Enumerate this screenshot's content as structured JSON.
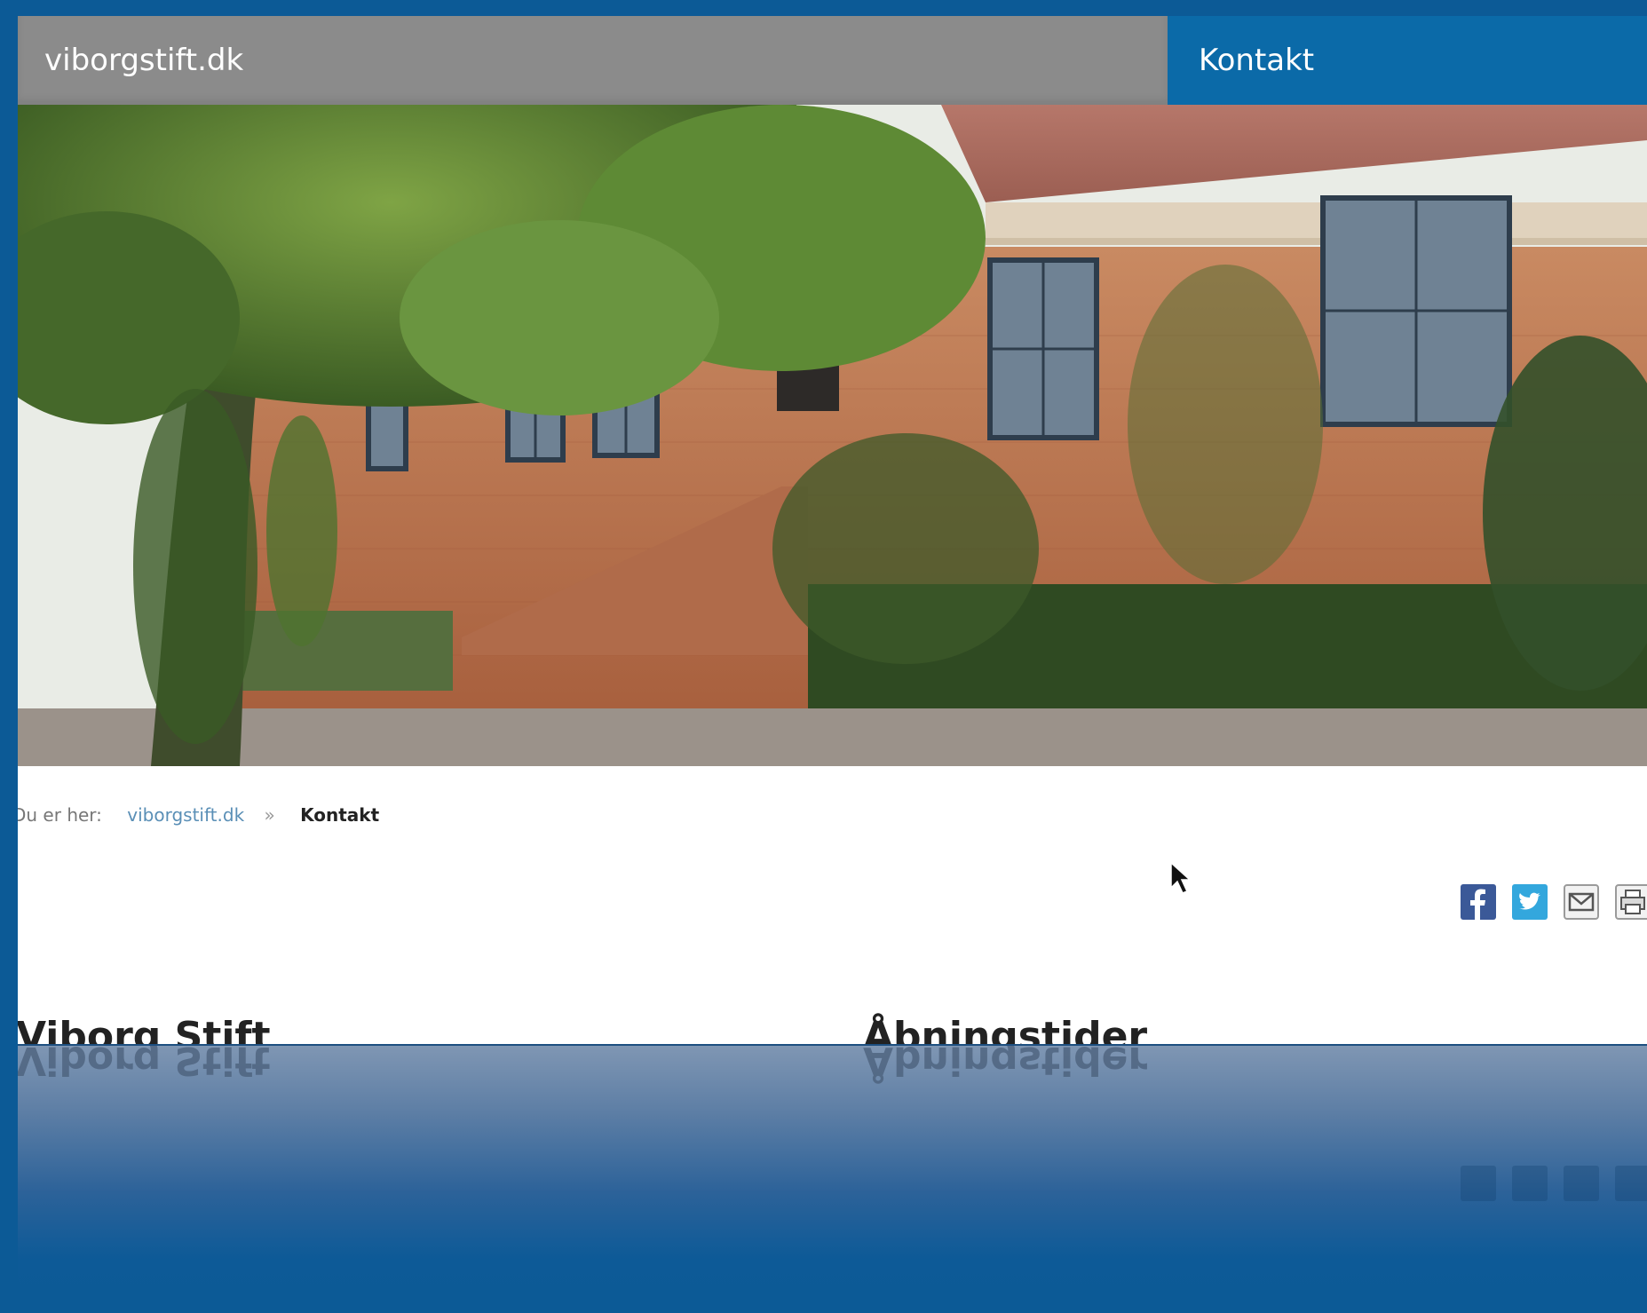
{
  "header": {
    "site_title": "viborgstift.dk",
    "nav_link": "Kontakt"
  },
  "hero": {
    "image": "Brick building with tree and garden"
  },
  "breadcrumb": {
    "prefix": "Du er her:",
    "home": "viborgstift.dk",
    "separator": "»",
    "current": "Kontakt"
  },
  "share": {
    "icons": [
      "facebook-icon",
      "twitter-icon",
      "email-icon",
      "print-icon"
    ]
  },
  "sections": {
    "left_heading": "Viborg Stift",
    "right_heading": "Åbningstider"
  },
  "colors": {
    "frame": "#0c5a96",
    "header_gray": "#8b8b8b",
    "nav_blue": "#0b6aa8"
  }
}
